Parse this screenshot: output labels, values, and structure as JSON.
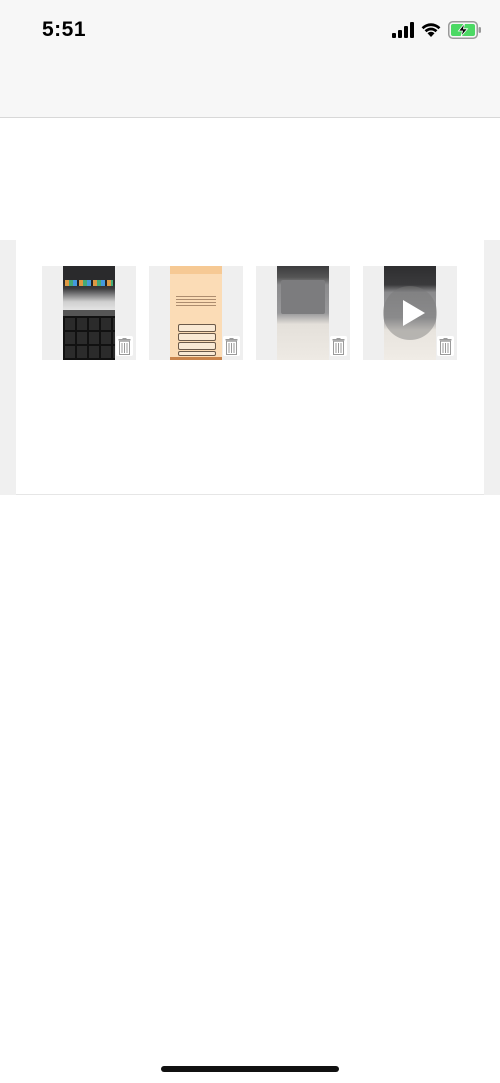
{
  "status_bar": {
    "time": "5:51",
    "icons": [
      "signal-icon",
      "wifi-icon",
      "battery-charging-icon"
    ],
    "battery_color": "#4cd964"
  },
  "gallery": {
    "items": [
      {
        "kind": "photo",
        "subject": "laptop-keyboard",
        "action_icon": "trash-icon"
      },
      {
        "kind": "photo",
        "subject": "app-screenshot",
        "action_icon": "trash-icon"
      },
      {
        "kind": "photo",
        "subject": "laptop-trackpad",
        "action_icon": "trash-icon"
      },
      {
        "kind": "video",
        "subject": "laptop-trackpad",
        "overlay_icon": "play-icon",
        "action_icon": "trash-icon"
      }
    ]
  }
}
